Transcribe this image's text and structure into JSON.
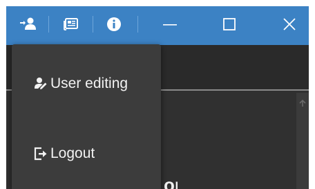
{
  "titlebar": {
    "color": "#3c82c4",
    "buttons": [
      {
        "icon": "user-switch-icon"
      },
      {
        "icon": "news-icon"
      },
      {
        "icon": "info-icon"
      }
    ],
    "window_controls": [
      {
        "icon": "minimize-icon"
      },
      {
        "icon": "maximize-icon"
      },
      {
        "icon": "close-icon"
      }
    ]
  },
  "menu": {
    "items": [
      {
        "label": "User editing",
        "icon": "user-edit-icon"
      },
      {
        "label": "Logout",
        "icon": "logout-icon"
      }
    ]
  },
  "background_text": "or",
  "scrollbar": {
    "icon": "arrow-up-icon"
  }
}
